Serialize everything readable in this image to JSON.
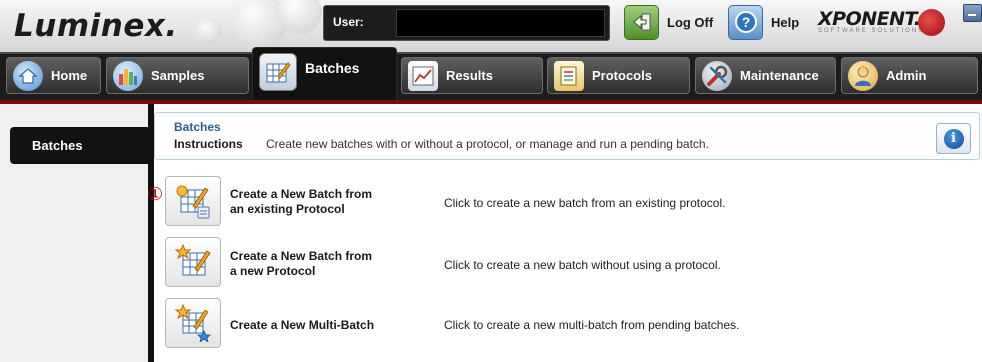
{
  "app": {
    "logo_text": "Luminex.",
    "user_label": "User:",
    "user_value": "",
    "logoff_label": "Log Off",
    "help_label": "Help",
    "brand_word": "XPONENT.",
    "brand_sub": "SOFTWARE SOLUTIONS"
  },
  "nav": {
    "tabs": [
      {
        "label": "Home",
        "icon": "home-icon"
      },
      {
        "label": "Samples",
        "icon": "samples-icon"
      },
      {
        "label": "Batches",
        "icon": "batches-icon",
        "active": true
      },
      {
        "label": "Results",
        "icon": "results-icon"
      },
      {
        "label": "Protocols",
        "icon": "protocols-icon"
      },
      {
        "label": "Maintenance",
        "icon": "maintenance-icon"
      },
      {
        "label": "Admin",
        "icon": "admin-icon"
      }
    ]
  },
  "sidebar": {
    "items": [
      {
        "label": "Batches",
        "selected": true
      }
    ]
  },
  "main": {
    "title": "Batches",
    "instructions_label": "Instructions",
    "instructions_text": "Create new batches with or without a protocol, or manage and run a pending batch.",
    "callout_marker": "①",
    "actions": [
      {
        "line1": "Create a New Batch from",
        "line2": "an existing Protocol",
        "description": "Click to create a new batch from an existing protocol.",
        "icon": "batch-from-protocol-icon"
      },
      {
        "line1": "Create a New Batch from",
        "line2": "a new Protocol",
        "description": "Click to create a new batch without using a protocol.",
        "icon": "batch-new-protocol-icon"
      },
      {
        "line1": "Create a New Multi-Batch",
        "line2": "",
        "description": "Click to create a new multi-batch from pending batches.",
        "icon": "multi-batch-icon"
      }
    ]
  },
  "colors": {
    "accent_blue": "#2f5f9a",
    "nav_background": "#1c1c1c",
    "divider_red": "#7a0d12",
    "callout_red": "#c00000"
  }
}
